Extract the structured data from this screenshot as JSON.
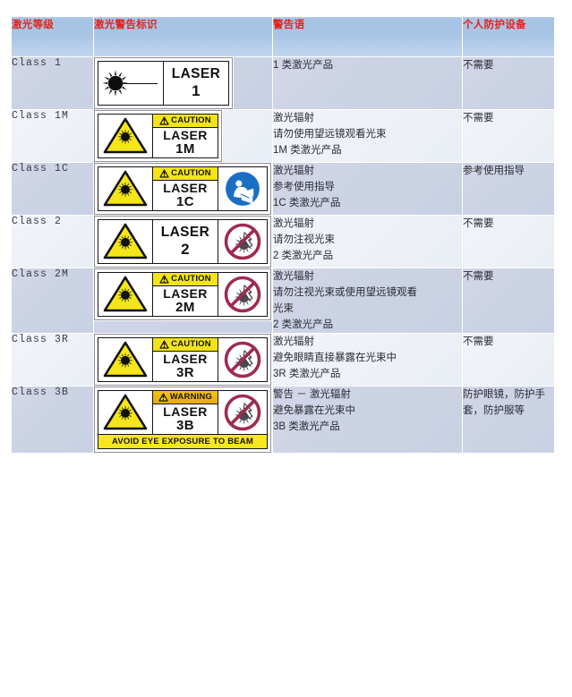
{
  "table": {
    "headers": [
      {
        "id": "class",
        "label": "激光等级"
      },
      {
        "id": "sign",
        "label": "激光警告标识"
      },
      {
        "id": "warning",
        "label": "警告语"
      },
      {
        "id": "ppe",
        "label": "个人防护设备"
      }
    ],
    "rows": [
      {
        "class": "Class 1",
        "sign": {
          "kind": "burst",
          "band": null,
          "laser_text": "LASER",
          "class_text": "1",
          "prohibition": false,
          "mandatory": false,
          "footer": null
        },
        "warning": "1 类激光产品",
        "ppe": "不需要"
      },
      {
        "class": "Class 1M",
        "sign": {
          "kind": "triangle",
          "band": "CAUTION",
          "laser_text": "LASER",
          "class_text": "1M",
          "prohibition": false,
          "mandatory": false,
          "footer": null
        },
        "warning": "激光辐射\n请勿使用望远镜观看光束\n1M 类激光产品",
        "ppe": "不需要"
      },
      {
        "class": "Class 1C",
        "sign": {
          "kind": "triangle",
          "band": "CAUTION",
          "laser_text": "LASER",
          "class_text": "1C",
          "prohibition": false,
          "mandatory": true,
          "footer": null
        },
        "warning": "激光辐射\n参考使用指导\n1C 类激光产品",
        "ppe": "参考使用指导"
      },
      {
        "class": "Class 2",
        "sign": {
          "kind": "triangle",
          "band": null,
          "laser_text": "LASER",
          "class_text": "2",
          "prohibition": true,
          "mandatory": false,
          "footer": null
        },
        "warning": "激光辐射\n请勿注视光束\n2 类激光产品",
        "ppe": "不需要"
      },
      {
        "class": "Class 2M",
        "sign": {
          "kind": "triangle",
          "band": "CAUTION",
          "laser_text": "LASER",
          "class_text": "2M",
          "prohibition": true,
          "mandatory": false,
          "footer": null
        },
        "warning": "激光辐射\n请勿注视光束或使用望远镜观看\n光束\n2 类激光产品",
        "ppe": "不需要"
      },
      {
        "class": "Class 3R",
        "sign": {
          "kind": "triangle",
          "band": "CAUTION",
          "laser_text": "LASER",
          "class_text": "3R",
          "prohibition": true,
          "mandatory": false,
          "footer": null
        },
        "warning": "激光辐射\n避免眼睛直接暴露在光束中\n3R 类激光产品",
        "ppe": "不需要"
      },
      {
        "class": "Class 3B",
        "sign": {
          "kind": "triangle",
          "band": "WARNING",
          "laser_text": "LASER",
          "class_text": "3B",
          "prohibition": true,
          "mandatory": false,
          "footer": "AVOID EYE EXPOSURE TO BEAM"
        },
        "warning": "警告 － 激光辐射\n避免暴露在光束中\n3B 类激光产品",
        "ppe": "防护眼镜，防护手套，防护服等"
      }
    ]
  },
  "colors": {
    "header_text": "#e2231a",
    "header_bg": "#a8c4e4",
    "row_tint": "#ccd3e5",
    "row_plain": "#eef1f7",
    "caution_yellow": "#f2e416",
    "warning_amber": "#f0b414",
    "prohibition_red": "#9e2b4e",
    "mandatory_blue": "#1a6fc4",
    "hazard_yellow": "#f5e61a"
  }
}
